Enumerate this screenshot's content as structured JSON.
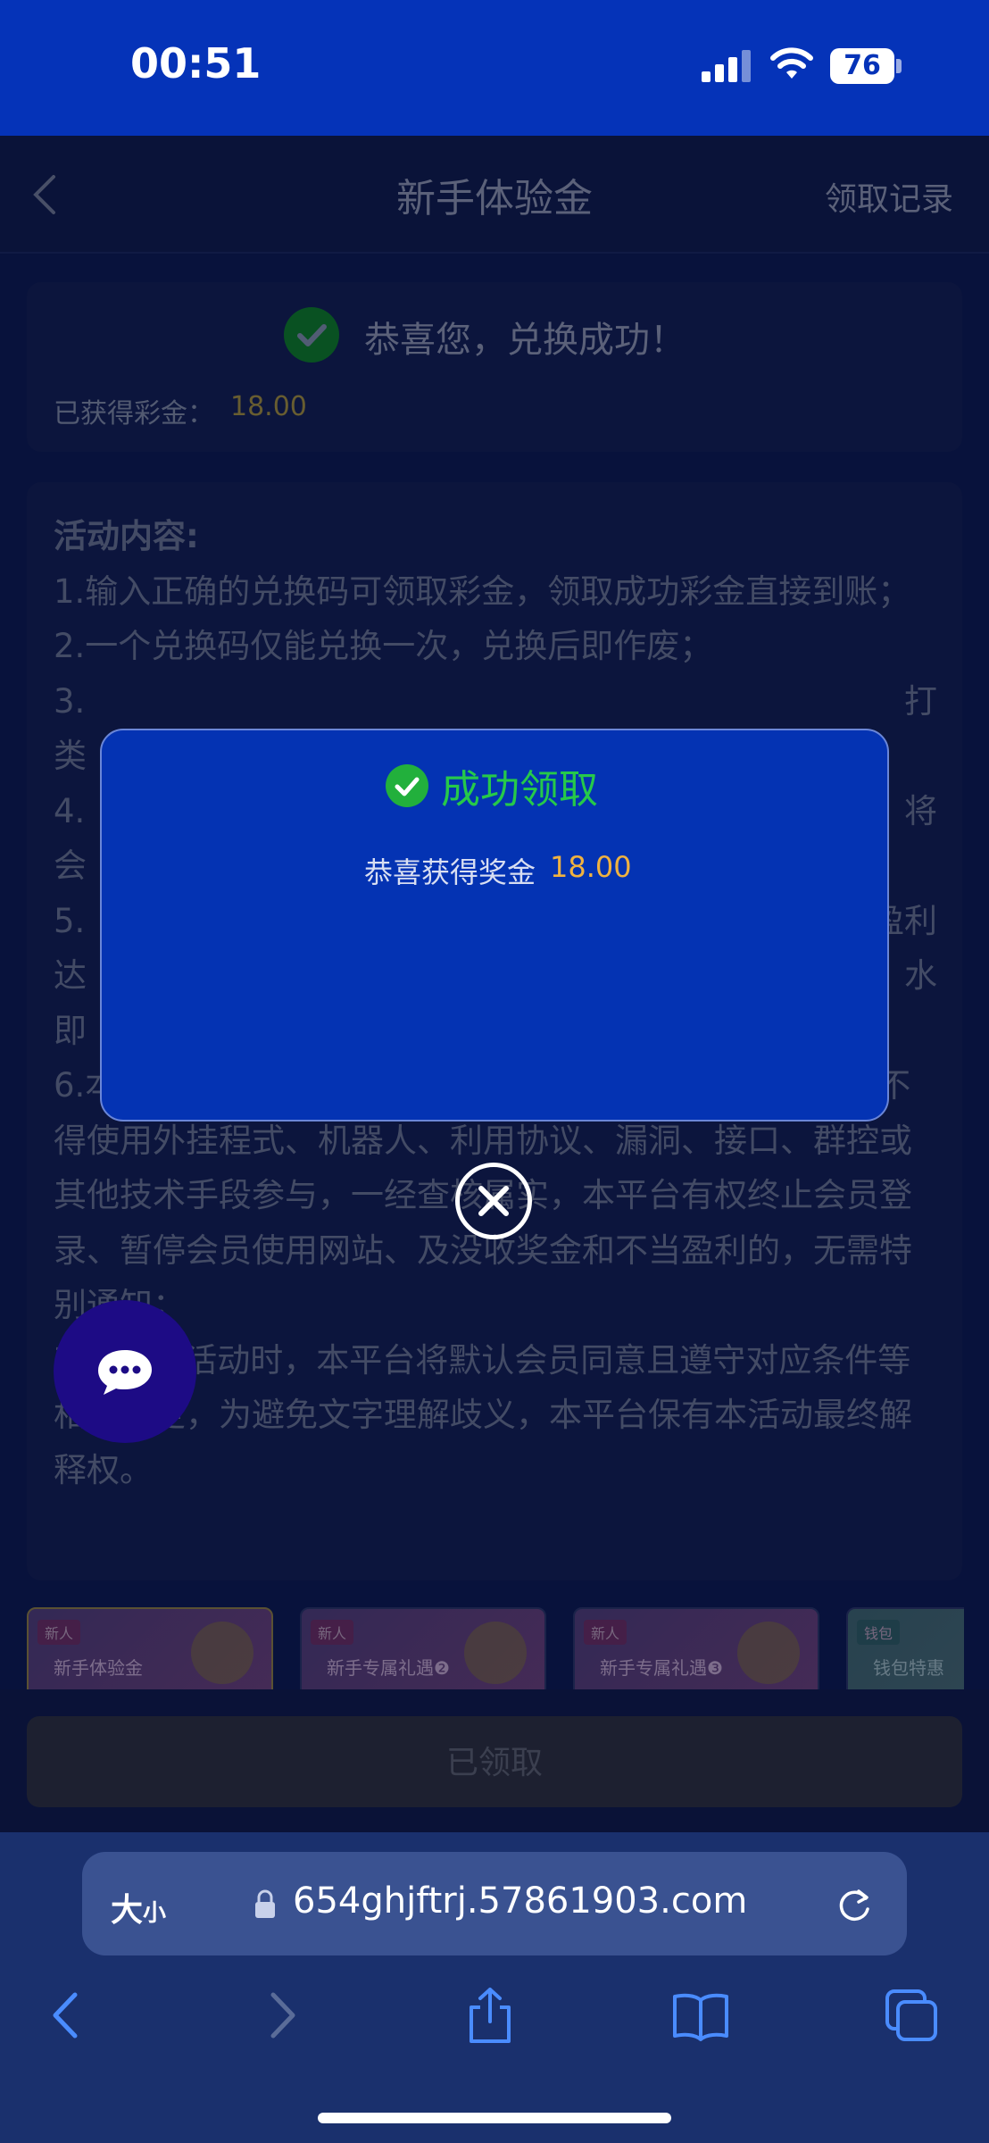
{
  "status_bar": {
    "time": "00:51",
    "battery": "76"
  },
  "header": {
    "title": "新手体验金",
    "records_link": "领取记录"
  },
  "result_card": {
    "message": "恭喜您，兑换成功！",
    "earned_label": "已获得彩金：",
    "earned_value": "18.00"
  },
  "rules": {
    "title": "活动内容:",
    "items": [
      "1.输入正确的兑换码可领取彩金，领取成功彩金直接到账；",
      "2.一个兑换码仅能兑换一次，兑换后即作废；",
      "3.",
      "4.",
      "5.",
      "6.本活动仅限账号本人进行兑换码兑换，禁止租借账号、不得使用外挂程式、机器人、利用协议、漏洞、接口、群控或其他技术手段参与，一经查核属实，本平台有权终止会员登录、暂停会员使用网站、及没收奖金和不当盈利的，无需特别通知；",
      "7.参与该活动时，本平台将默认会员同意且遵守对应条件等相关规定，为避免文字理解歧义，本平台保有本活动最终解释权。"
    ],
    "fragments": [
      "类",
      "会",
      "达",
      "即",
      "打",
      "将",
      "盈利",
      "水"
    ]
  },
  "promo_tabs": [
    {
      "tag": "新人",
      "title": "新手体验金"
    },
    {
      "tag": "新人",
      "title": "新手专属礼遇❷"
    },
    {
      "tag": "新人",
      "title": "新手专属礼遇❸"
    },
    {
      "tag": "钱包",
      "title": "钱包特惠"
    }
  ],
  "claim_button": {
    "label": "已领取"
  },
  "modal": {
    "title": "成功领取",
    "text": "恭喜获得奖金",
    "amount": "18.00"
  },
  "browser": {
    "text_size_label": "大",
    "text_size_small": "小",
    "url": "654ghjftrj.57861903.com"
  },
  "colors": {
    "modal_bg": "#0433b3",
    "success_green": "#26c94a",
    "amount_orange": "#f0b240",
    "status_bar_blue": "#0533b8"
  }
}
